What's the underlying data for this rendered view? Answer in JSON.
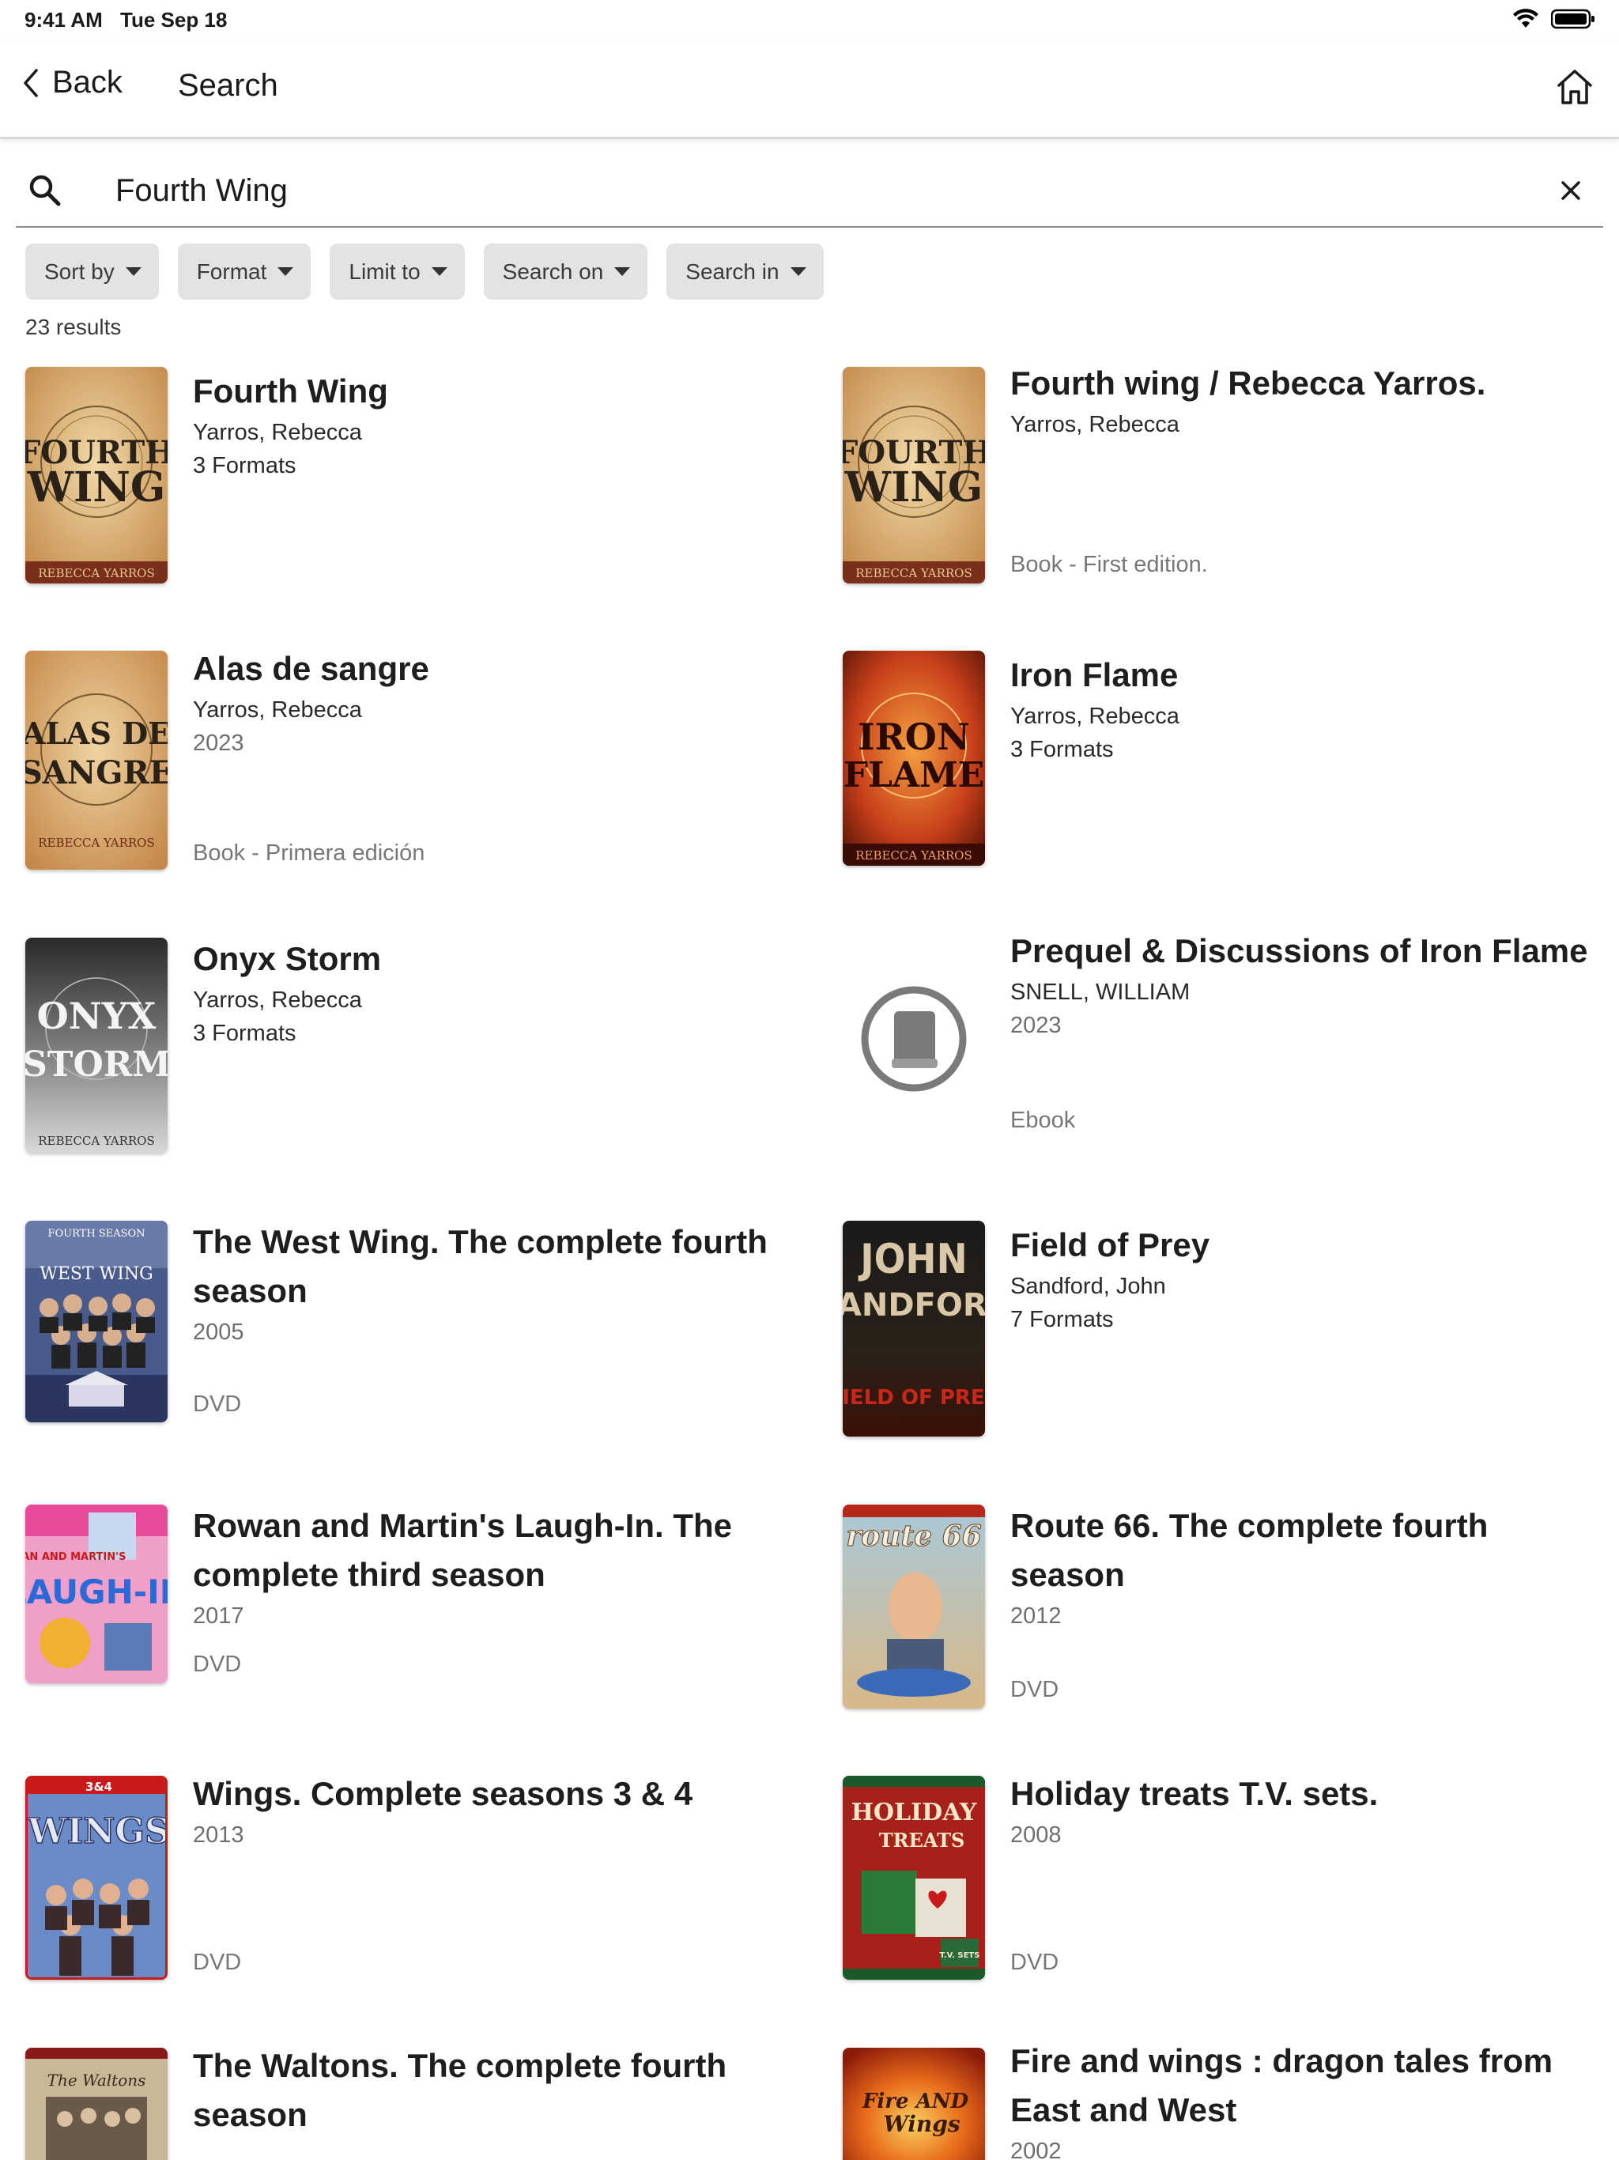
{
  "status": {
    "time": "9:41 AM",
    "date": "Tue Sep 18"
  },
  "nav": {
    "back_label": "Back",
    "title": "Search"
  },
  "search": {
    "value": "Fourth Wing"
  },
  "filters": [
    "Sort by",
    "Format",
    "Limit to",
    "Search on",
    "Search in"
  ],
  "results_count": "23 results",
  "results": [
    {
      "title": "Fourth Wing",
      "author": "Yarros, Rebecca",
      "formats": "3 Formats",
      "cover": "Fourth Wing book cover"
    },
    {
      "title": "Fourth wing / Rebecca Yarros.",
      "author": "Yarros, Rebecca",
      "type": "Book - First edition.",
      "cover": "Fourth Wing book cover"
    },
    {
      "title": "Alas de sangre",
      "author": "Yarros, Rebecca",
      "year": "2023",
      "type": "Book - Primera edición",
      "cover": "Alas de Sangre book cover"
    },
    {
      "title": "Iron Flame",
      "author": "Yarros, Rebecca",
      "formats": "3 Formats",
      "cover": "Iron Flame book cover"
    },
    {
      "title": "Onyx Storm",
      "author": "Yarros, Rebecca",
      "formats": "3 Formats",
      "cover": "Onyx Storm book cover"
    },
    {
      "title": "Prequel & Discussions of Iron Flame",
      "author": "SNELL, WILLIAM",
      "year": "2023",
      "type": "Ebook",
      "cover": "generic book icon"
    },
    {
      "title": "The West Wing. The complete fourth season",
      "year": "2005",
      "type": "DVD",
      "cover": "The West Wing DVD cover"
    },
    {
      "title": "Field of Prey",
      "author": "Sandford, John",
      "formats": "7 Formats",
      "cover": "Field of Prey book cover"
    },
    {
      "title": "Rowan and Martin's Laugh-In. The complete third season",
      "year": "2017",
      "type": "DVD",
      "cover": "Laugh-In DVD cover"
    },
    {
      "title": "Route 66. The complete fourth season",
      "year": "2012",
      "type": "DVD",
      "cover": "Route 66 DVD cover"
    },
    {
      "title": "Wings. Complete seasons 3 & 4",
      "year": "2013",
      "type": "DVD",
      "cover": "Wings DVD cover"
    },
    {
      "title": "Holiday treats T.V. sets.",
      "year": "2008",
      "type": "DVD",
      "cover": "Holiday Treats DVD cover"
    },
    {
      "title": "The Waltons. The complete fourth season",
      "cover": "The Waltons DVD cover"
    },
    {
      "title": "Fire and wings : dragon tales from East and West",
      "year": "2002",
      "cover": "Fire and Wings book cover"
    }
  ],
  "cover_texts": {
    "fourth_wing": [
      "FOURTH",
      "WING",
      "REBECCA YARROS"
    ],
    "alas": [
      "ALAS DE",
      "SANGRE",
      "REBECCA YARROS"
    ],
    "iron": [
      "IRON",
      "FLAME",
      "REBECCA YARROS"
    ],
    "onyx": [
      "ONYX",
      "STORM",
      "REBECCA YARROS"
    ],
    "west_wing": [
      "FOURTH SEASON",
      "WEST WING"
    ],
    "sandford": [
      "JOHN",
      "SANDFORD",
      "FIELD OF PREY"
    ],
    "laugh_in": [
      "ROWAN AND MARTIN'S",
      "LAUGH-IN"
    ],
    "route66": [
      "route 66"
    ],
    "wings": [
      "3&4",
      "WINGS"
    ],
    "holiday": [
      "HOLIDAY",
      "TREATS",
      "T.V. SETS"
    ],
    "waltons": [
      "The Waltons"
    ],
    "fire_wings": [
      "Fire AND",
      "Wings"
    ]
  }
}
